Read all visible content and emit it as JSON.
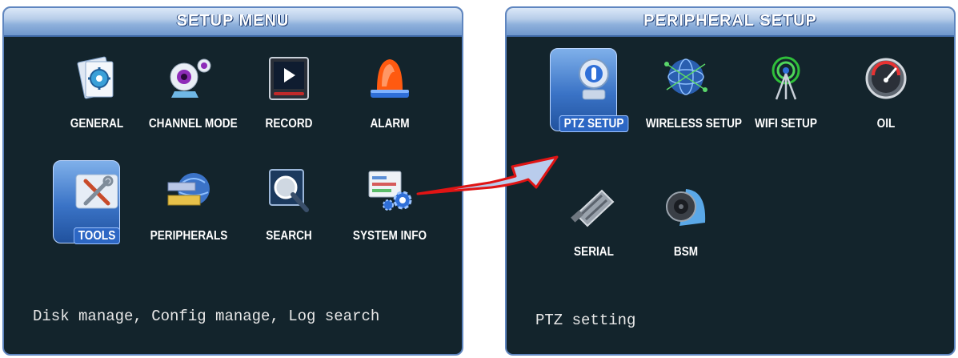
{
  "left": {
    "title": "SETUP  MENU",
    "items": [
      {
        "label": "GENERAL"
      },
      {
        "label": "CHANNEL MODE"
      },
      {
        "label": "RECORD"
      },
      {
        "label": "ALARM"
      },
      {
        "label": "TOOLS",
        "selected": true
      },
      {
        "label": "PERIPHERALS"
      },
      {
        "label": "SEARCH"
      },
      {
        "label": "SYSTEM INFO"
      }
    ],
    "status": "Disk manage, Config manage, Log search"
  },
  "right": {
    "title": "PERIPHERAL  SETUP",
    "items": [
      {
        "label": "PTZ SETUP",
        "selected": true
      },
      {
        "label": "WIRELESS SETUP"
      },
      {
        "label": "WIFI SETUP"
      },
      {
        "label": "OIL"
      },
      {
        "label": "SERIAL"
      },
      {
        "label": "BSM"
      }
    ],
    "status": "PTZ setting"
  },
  "colors": {
    "panel_bg": "#13242c",
    "title_gradient": "#8fb1dc",
    "selection": "#2d67c4",
    "arrow_red": "#e01414"
  }
}
